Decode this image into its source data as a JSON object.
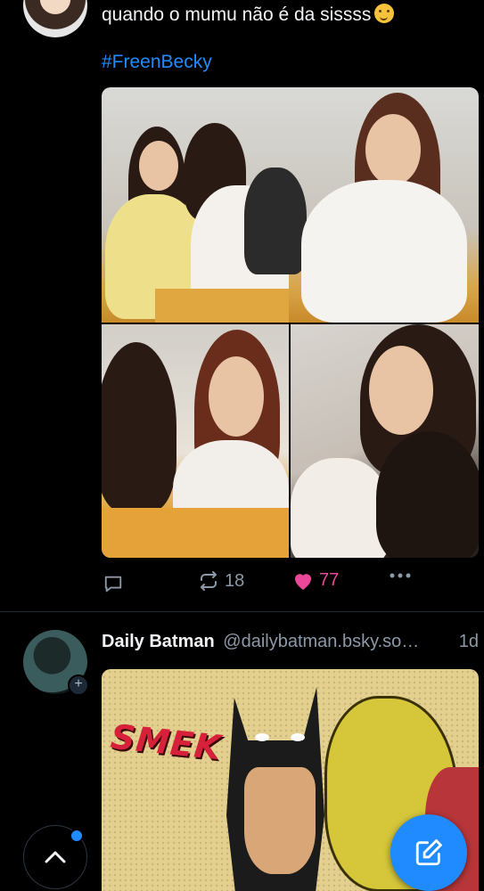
{
  "post1": {
    "text": "quando o mumu não é da sissss",
    "emoji": "shushing-face-emoji",
    "hashtag": "#FreenBecky",
    "stats": {
      "reposts": "18",
      "likes": "77"
    }
  },
  "post2": {
    "author_name": "Daily Batman",
    "author_handle": "@dailybatman.bsky.so…",
    "time": "1d",
    "comic_sfx": "SMEK"
  },
  "colors": {
    "accent": "#208bfe",
    "like": "#ec4899",
    "muted": "#8d99a8",
    "background": "#000000"
  },
  "icons": [
    "reply-icon",
    "repost-icon",
    "heart-icon",
    "more-icon",
    "chevron-up-icon",
    "compose-icon",
    "plus-icon"
  ]
}
